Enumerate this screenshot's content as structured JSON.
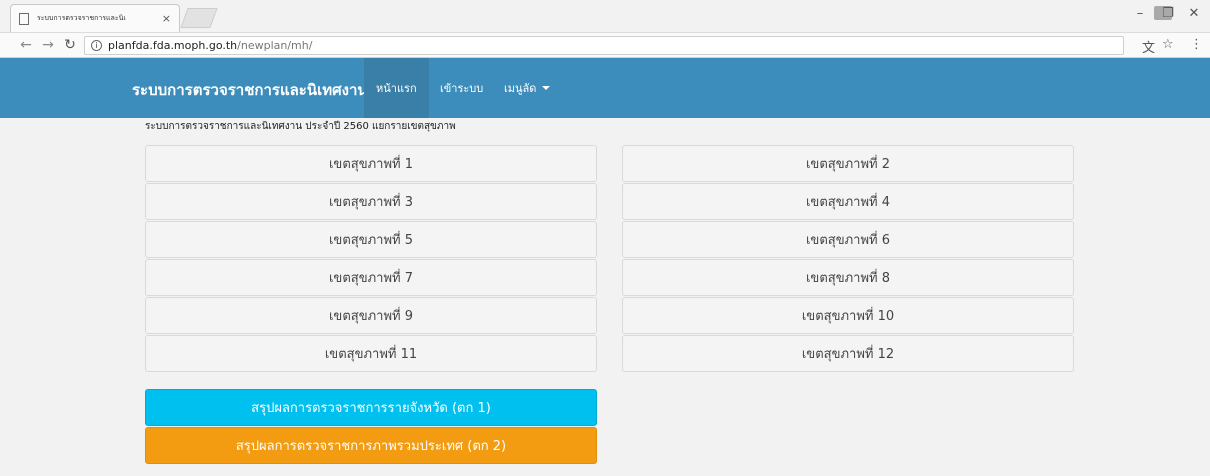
{
  "browser": {
    "tab_title": "ระบบการตรวจราชการและนิเ",
    "tab_close": "×",
    "url_host": "planfda.fda.moph.go.th",
    "url_path": "/newplan/mh/",
    "icons": [
      "doc-icon",
      "back-icon",
      "forward-icon",
      "reload-icon",
      "info-icon",
      "translate-icon",
      "star-icon",
      "menu-icon"
    ]
  },
  "nav": {
    "brand": "ระบบการตรวจราชการและนิเทศงาน",
    "home": "หน้าแรก",
    "login": "เข้าระบบ",
    "shortcuts": "เมนูลัด"
  },
  "content": {
    "heading": "ระบบการตรวจราชการและนิเทศงาน ประจำปี 2560 แยกรายเขตสุขภาพ",
    "regions": [
      "เขตสุขภาพที่ 1",
      "เขตสุขภาพที่ 2",
      "เขตสุขภาพที่ 3",
      "เขตสุขภาพที่ 4",
      "เขตสุขภาพที่ 5",
      "เขตสุขภาพที่ 6",
      "เขตสุขภาพที่ 7",
      "เขตสุขภาพที่ 8",
      "เขตสุขภาพที่ 9",
      "เขตสุขภาพที่ 10",
      "เขตสุขภาพที่ 11",
      "เขตสุขภาพที่ 12"
    ],
    "summary_province": "สรุปผลการตรวจราชการรายจังหวัด (ตก 1)",
    "summary_country": "สรุปผลการตรวจราชการภาพรวมประเทศ (ตก 2)"
  },
  "colors": {
    "navbar": "#3c8dbc",
    "info_button": "#00c0ef",
    "warning_button": "#f39c12"
  }
}
